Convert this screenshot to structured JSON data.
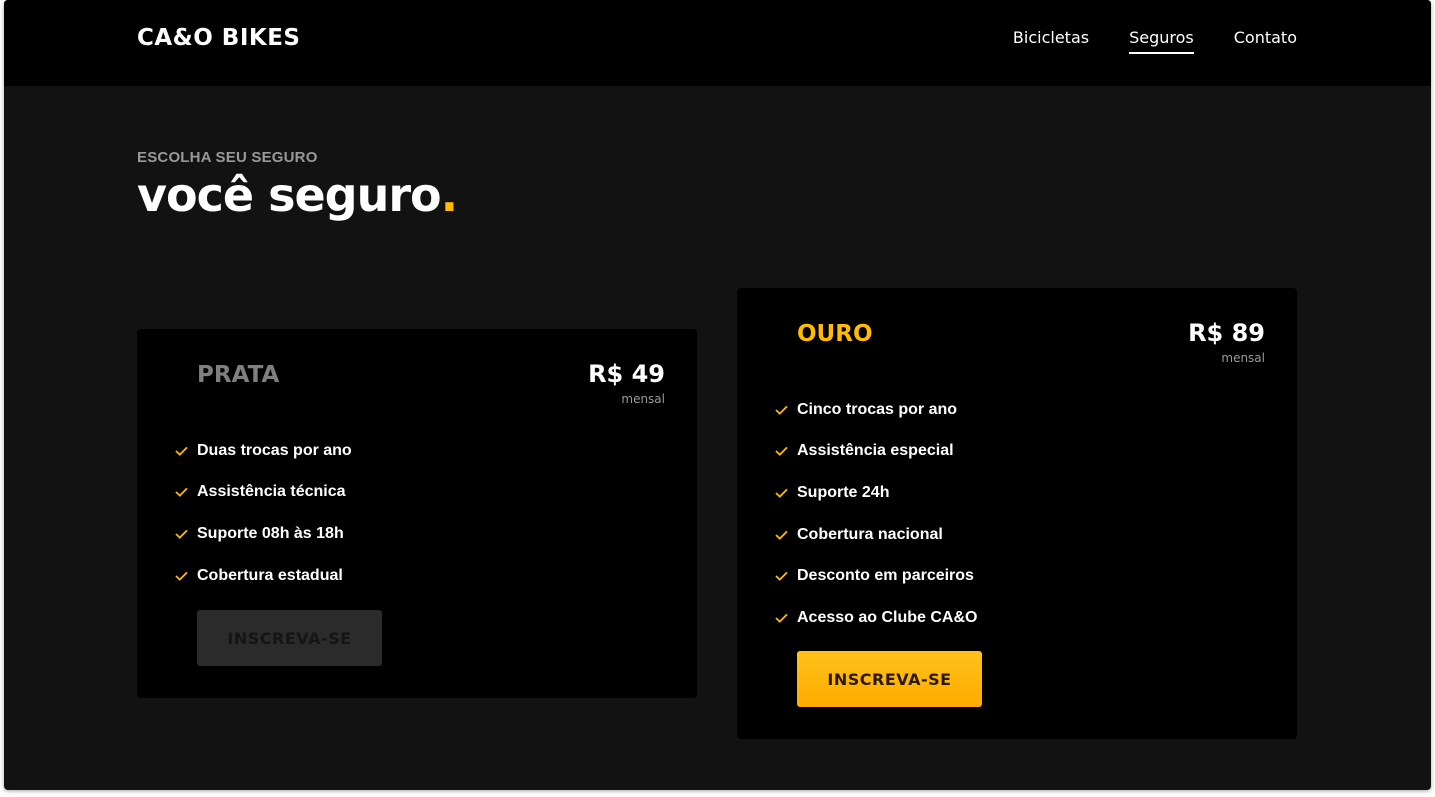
{
  "header": {
    "logo": "CA&O BIKES",
    "nav": [
      {
        "label": "Bicicletas",
        "active": false
      },
      {
        "label": "Seguros",
        "active": true
      },
      {
        "label": "Contato",
        "active": false
      }
    ]
  },
  "hero": {
    "eyebrow": "ESCOLHA SEU SEGURO",
    "title": "você seguro",
    "title_dot": "."
  },
  "plans": [
    {
      "name": "PRATA",
      "price": "R$ 49",
      "period": "mensal",
      "features": [
        "Duas trocas por ano",
        "Assistência técnica",
        "Suporte 08h às 18h",
        "Cobertura estadual"
      ],
      "button_label": "INSCREVA-SE"
    },
    {
      "name": "OURO",
      "price": "R$ 89",
      "period": "mensal",
      "features": [
        "Cinco trocas por ano",
        "Assistência especial",
        "Suporte 24h",
        "Cobertura nacional",
        "Desconto em parceiros",
        "Acesso ao Clube CA&O"
      ],
      "button_label": "INSCREVA-SE"
    }
  ],
  "icons": {
    "feature_check": "check-icon"
  },
  "colors": {
    "accent": "#ffbb00",
    "background": "#121212",
    "header_bg": "#000000",
    "card_bg": "#000000",
    "muted": "#7f7f7f"
  }
}
